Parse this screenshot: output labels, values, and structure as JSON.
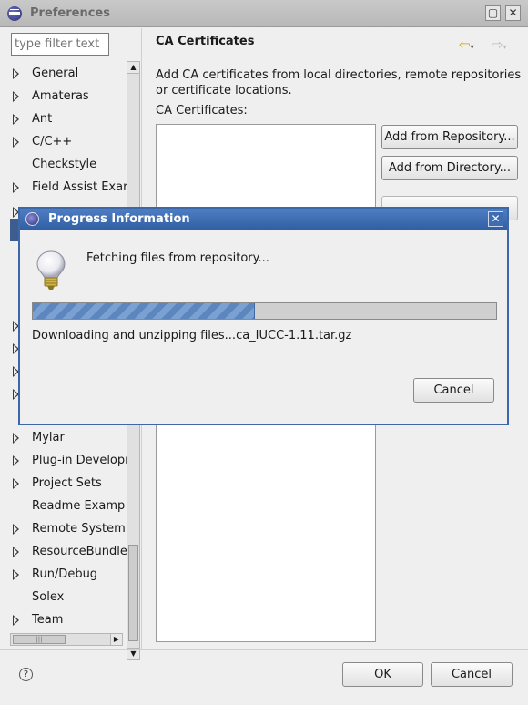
{
  "window": {
    "title": "Preferences",
    "buttons": {
      "maximize": "▢",
      "close": "✕"
    }
  },
  "sidebar": {
    "filter_placeholder": "type filter text",
    "items": [
      {
        "label": "General",
        "expandable": true
      },
      {
        "label": "Amateras",
        "expandable": true
      },
      {
        "label": "Ant",
        "expandable": true
      },
      {
        "label": "C/C++",
        "expandable": true
      },
      {
        "label": "Checkstyle",
        "expandable": false
      },
      {
        "label": "Field Assist Exar",
        "expandable": true
      },
      {
        "label": "Mylar",
        "expandable": true
      },
      {
        "label": "Plug-in Developı",
        "expandable": true
      },
      {
        "label": "Project Sets",
        "expandable": true
      },
      {
        "label": "Readme Examp",
        "expandable": false
      },
      {
        "label": "Remote System",
        "expandable": true
      },
      {
        "label": "ResourceBundle",
        "expandable": true
      },
      {
        "label": "Run/Debug",
        "expandable": true
      },
      {
        "label": "Solex",
        "expandable": false
      },
      {
        "label": "Team",
        "expandable": true
      }
    ]
  },
  "page": {
    "title": "CA Certificates",
    "description": "Add CA certificates from local directories, remote repositories or certificate locations.",
    "list_label": "CA Certificates:",
    "buttons": {
      "add_from_repository": "Add from Repository...",
      "add_from_directory": "Add from Directory..."
    },
    "nav": {
      "back": "⇦",
      "forward": "⇨",
      "caret": "▾"
    }
  },
  "footer": {
    "help": "?",
    "ok": "OK",
    "cancel": "Cancel"
  },
  "progress_dialog": {
    "title": "Progress Information",
    "close": "✕",
    "message": "Fetching files from repository...",
    "progress_fraction": 0.48,
    "detail": "Downloading and unzipping files...ca_IUCC-1.11.tar.gz",
    "cancel": "Cancel"
  },
  "colors": {
    "dialog_title": "#3d68a8",
    "progress_fill": "#5c86bd"
  }
}
